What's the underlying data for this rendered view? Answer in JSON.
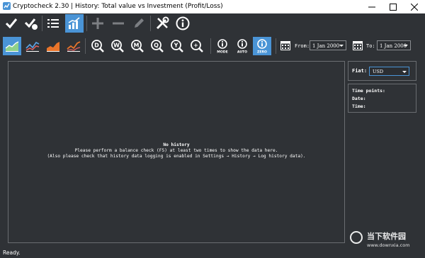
{
  "window": {
    "title": "Cryptocheck 2.30  |  History: Total value vs Investment (Profit/Loss)",
    "controls": [
      "minimize-icon",
      "maximize-icon",
      "close-icon"
    ]
  },
  "toolbar_main": {
    "buttons": [
      {
        "icon": "checkmark-icon",
        "active": false,
        "enabled": true
      },
      {
        "icon": "check-all-icon",
        "active": false,
        "enabled": true
      },
      {
        "icon": "list-icon",
        "active": false,
        "enabled": true
      },
      {
        "icon": "chart-icon",
        "active": true,
        "enabled": true
      },
      {
        "icon": "plus-icon",
        "active": false,
        "enabled": false
      },
      {
        "icon": "minus-icon",
        "active": false,
        "enabled": false
      },
      {
        "icon": "pencil-icon",
        "active": false,
        "enabled": false
      },
      {
        "icon": "tools-icon",
        "active": false,
        "enabled": true
      },
      {
        "icon": "info-icon",
        "active": false,
        "enabled": true
      }
    ]
  },
  "toolbar_history": {
    "chart_types": [
      "area-chart-icon",
      "line-chart-icon",
      "area-orange-icon",
      "line-orange-icon"
    ],
    "zoom_buttons": [
      {
        "icon": "zoom-day-icon",
        "letter": "D"
      },
      {
        "icon": "zoom-week-icon",
        "letter": "W"
      },
      {
        "icon": "zoom-month-icon",
        "letter": "M"
      },
      {
        "icon": "zoom-quarter-icon",
        "letter": "Q"
      },
      {
        "icon": "zoom-year-icon",
        "letter": "Y"
      },
      {
        "icon": "zoom-in-icon",
        "letter": "+"
      }
    ],
    "mode_buttons": [
      {
        "icon": "mode-icon",
        "caption": "MODE",
        "active": false
      },
      {
        "icon": "auto-icon",
        "caption": "AUTO",
        "active": false
      },
      {
        "icon": "zero-icon",
        "caption": "ZERO",
        "active": true
      }
    ],
    "from_label": "From:",
    "from_value": "1 Jan 2000",
    "to_label": "To:",
    "to_value": "1 Jan 2000"
  },
  "chart": {
    "title": "No history",
    "line1": "Please perform a balance check (F5) at least two times to show the data here.",
    "line2": "(Also please check that history data logging is enabled in Settings → History → Log history data)."
  },
  "side": {
    "fiat_label": "Fiat:",
    "fiat_value": "USD",
    "time_points_label": "Time points:",
    "date_label": "Date:",
    "time_label": "Time:"
  },
  "status": {
    "text": "Ready."
  },
  "watermark": {
    "title": "当下软件园",
    "url": "www.downxia.com"
  },
  "colors": {
    "background": "#2f3236",
    "accent": "#4a94d6",
    "titlebar": "#ffffff"
  }
}
